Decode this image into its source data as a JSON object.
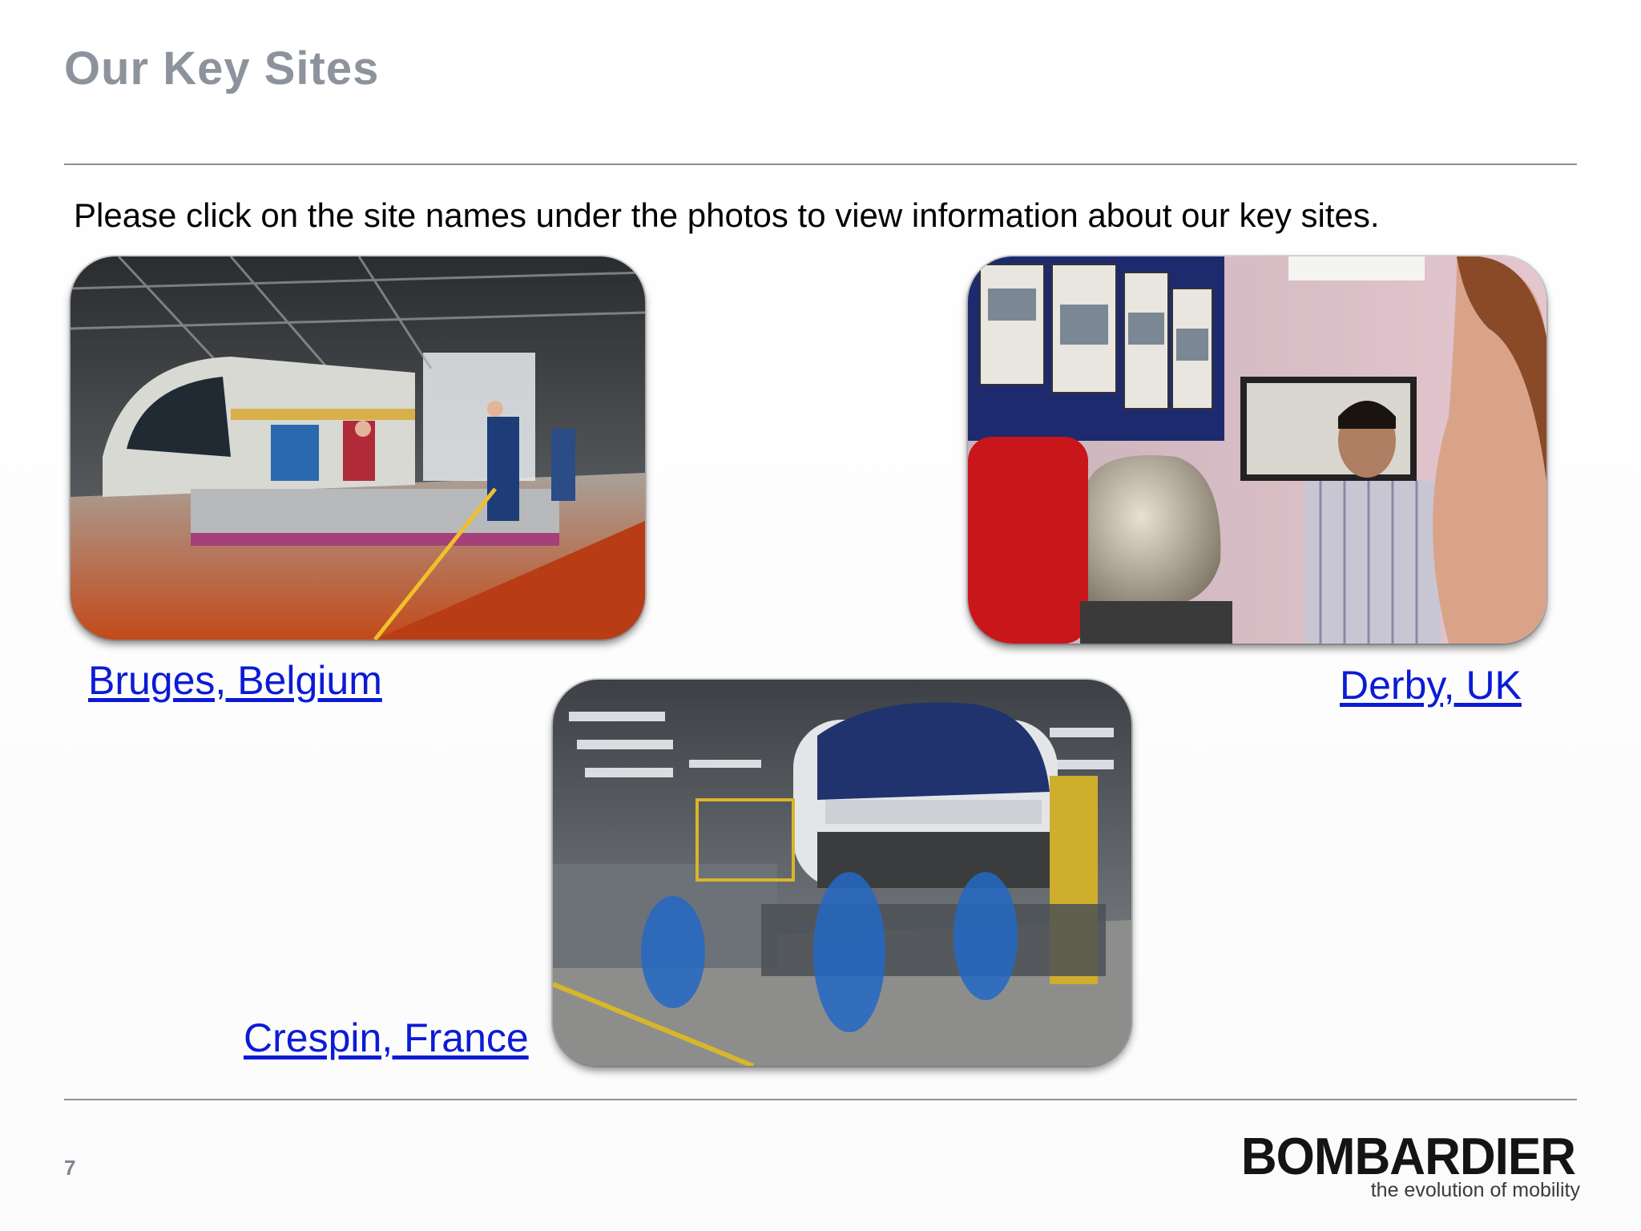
{
  "slide": {
    "title": "Our Key Sites",
    "instruction": "Please click on the site names under the photos to view information about our key sites.",
    "page_number": "7"
  },
  "sites": {
    "bruges": {
      "label": "Bruges, Belgium"
    },
    "derby": {
      "label": "Derby, UK"
    },
    "crespin": {
      "label": "Crespin, France"
    }
  },
  "logo": {
    "brand": "BOMBARDIER",
    "tagline": "the evolution of mobility"
  },
  "colors": {
    "title": "#8c939c",
    "link": "#0b1bd6",
    "rule": "#8a8f96"
  }
}
